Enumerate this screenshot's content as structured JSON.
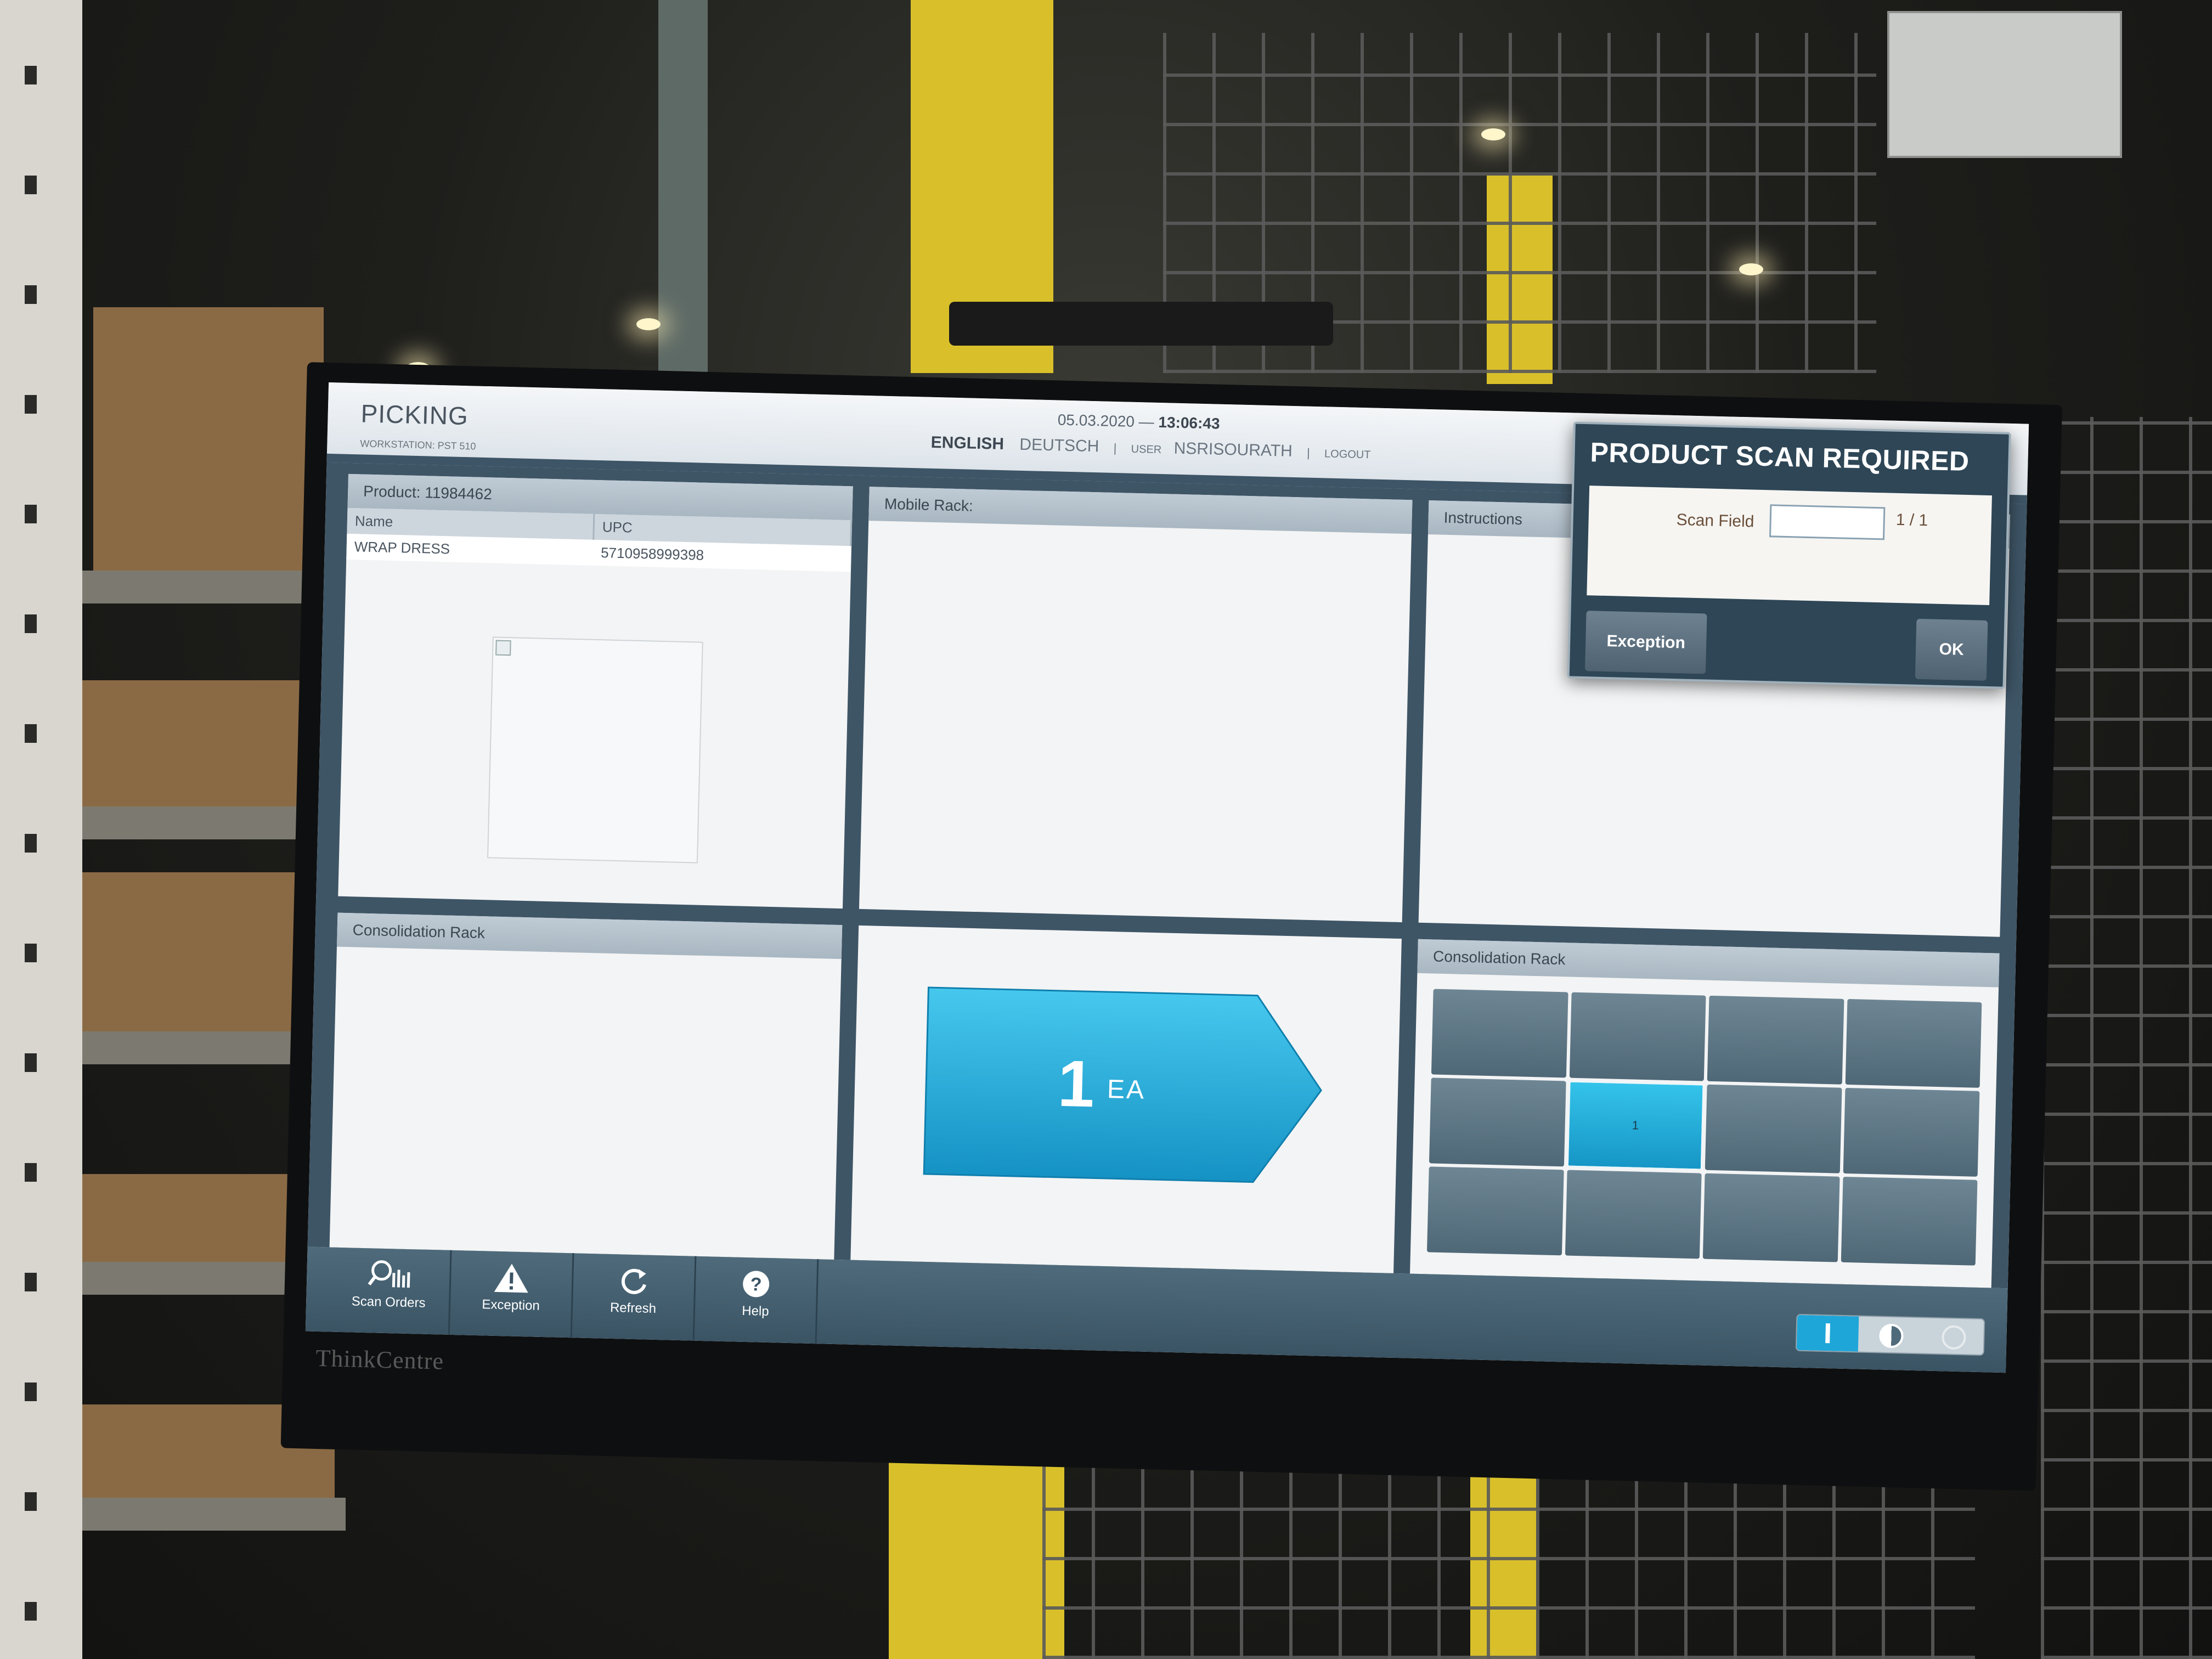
{
  "app": {
    "title": "PICKING",
    "workstation": "WORKSTATION: PST 510",
    "date": "05.03.2020",
    "date_sep": " — ",
    "time": "13:06:43",
    "languages": {
      "english": "ENGLISH",
      "deutsch": "DEUTSCH"
    },
    "user_label": "USER",
    "user_name": "NSRISOURATH",
    "logout": "LOGOUT"
  },
  "product_panel": {
    "title": "Product: 11984462",
    "columns": [
      "Name",
      "UPC"
    ],
    "rows": [
      [
        "WRAP DRESS",
        "5710958999398"
      ]
    ]
  },
  "mobile_rack_panel": {
    "title": "Mobile Rack:"
  },
  "instructions_panel": {
    "title": "Instructions"
  },
  "consolidation_left": {
    "title": "Consolidation Rack"
  },
  "quantity": {
    "value": "1",
    "unit": "EA",
    "color": "#1aa7d6"
  },
  "consolidation_right": {
    "title": "Consolidation Rack",
    "cells": [
      "",
      "",
      "",
      "",
      "",
      "1",
      "",
      "",
      "",
      "",
      "",
      ""
    ],
    "active_index": 5
  },
  "toolbar": {
    "buttons": [
      {
        "label": "Scan Orders",
        "icon": "scan-orders-icon"
      },
      {
        "label": "Exception",
        "icon": "warning-icon"
      },
      {
        "label": "Refresh",
        "icon": "refresh-icon"
      },
      {
        "label": "Help",
        "icon": "help-icon"
      }
    ]
  },
  "modal": {
    "title": "PRODUCT SCAN REQUIRED",
    "scan_label": "Scan Field",
    "scan_value": "",
    "scan_count": "1 / 1",
    "exception_label": "Exception",
    "ok_label": "OK"
  },
  "monitor": {
    "brand": "ThinkCentre"
  },
  "colors": {
    "accent": "#1aa7d6",
    "header_bar": "#3d5566",
    "toolbar": "#4a6576"
  }
}
